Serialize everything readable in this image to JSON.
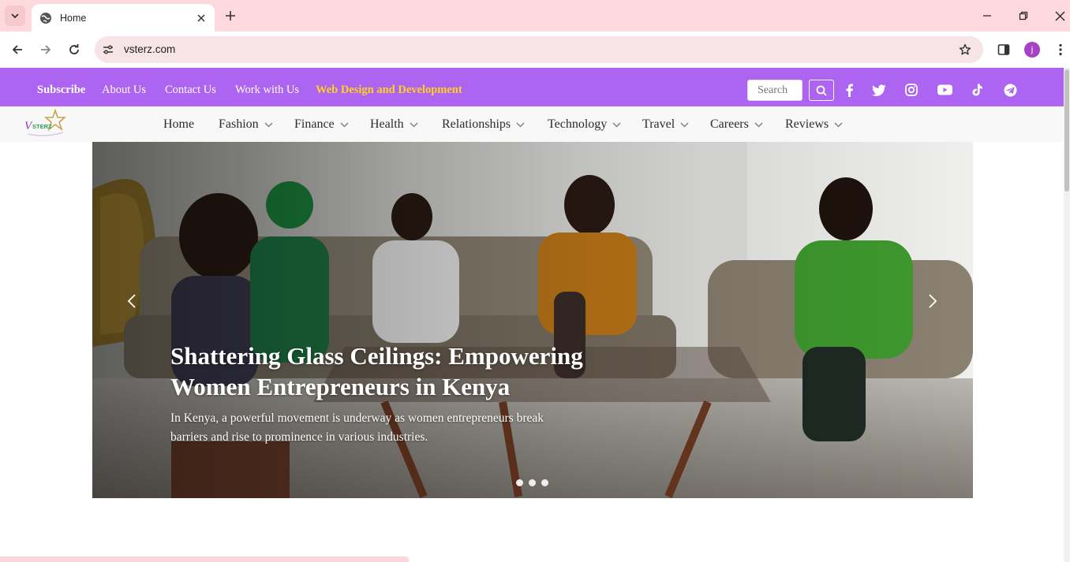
{
  "browser": {
    "tab_title": "Home",
    "url": "vsterz.com",
    "profile_initial": "j",
    "colors": {
      "tabstrip": "#fdd9dd",
      "omnibox": "#f6e4e6",
      "profile": "#a742c4"
    }
  },
  "topbar": {
    "links": [
      {
        "label": "Subscribe"
      },
      {
        "label": "About Us"
      },
      {
        "label": "Contact Us"
      },
      {
        "label": "Work with Us"
      },
      {
        "label": "Web Design and Development"
      }
    ],
    "search_placeholder": "Search",
    "social": [
      "facebook-icon",
      "twitter-icon",
      "instagram-icon",
      "youtube-icon",
      "tiktok-icon",
      "telegram-icon"
    ],
    "colors": {
      "background": "#ad64f0",
      "accent": "#ffd21f"
    }
  },
  "mainnav": {
    "logo_text": "VSTERZ",
    "items": [
      {
        "label": "Home"
      },
      {
        "label": "Fashion"
      },
      {
        "label": "Finance"
      },
      {
        "label": "Health"
      },
      {
        "label": "Relationships"
      },
      {
        "label": "Technology"
      },
      {
        "label": "Travel"
      },
      {
        "label": "Careers"
      },
      {
        "label": "Reviews"
      }
    ]
  },
  "hero": {
    "title": "Shattering Glass Ceilings: Empowering Women Entrepreneurs in Kenya",
    "description": "In Kenya, a powerful movement is underway as women entrepreneurs break barriers and rise to prominence in various industries.",
    "slide_count": 3
  }
}
